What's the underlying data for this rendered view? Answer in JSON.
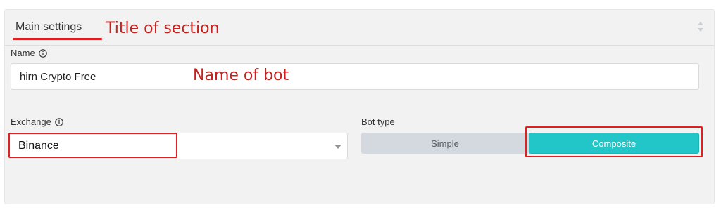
{
  "section": {
    "tab_title": "Main settings",
    "annotation": "Title of section"
  },
  "name_field": {
    "label": "Name",
    "value": "hirn Crypto Free",
    "annotation": "Name of bot"
  },
  "exchange_field": {
    "label": "Exchange",
    "selected": "Binance"
  },
  "bot_type": {
    "label": "Bot type",
    "options": [
      "Simple",
      "Composite"
    ],
    "selected": "Composite"
  },
  "colors": {
    "accent": "#23c6c8",
    "highlight": "#e02020",
    "annotation_text": "#c5221f"
  },
  "icons": [
    "info-icon",
    "sort-icon",
    "chevron-down-icon"
  ]
}
